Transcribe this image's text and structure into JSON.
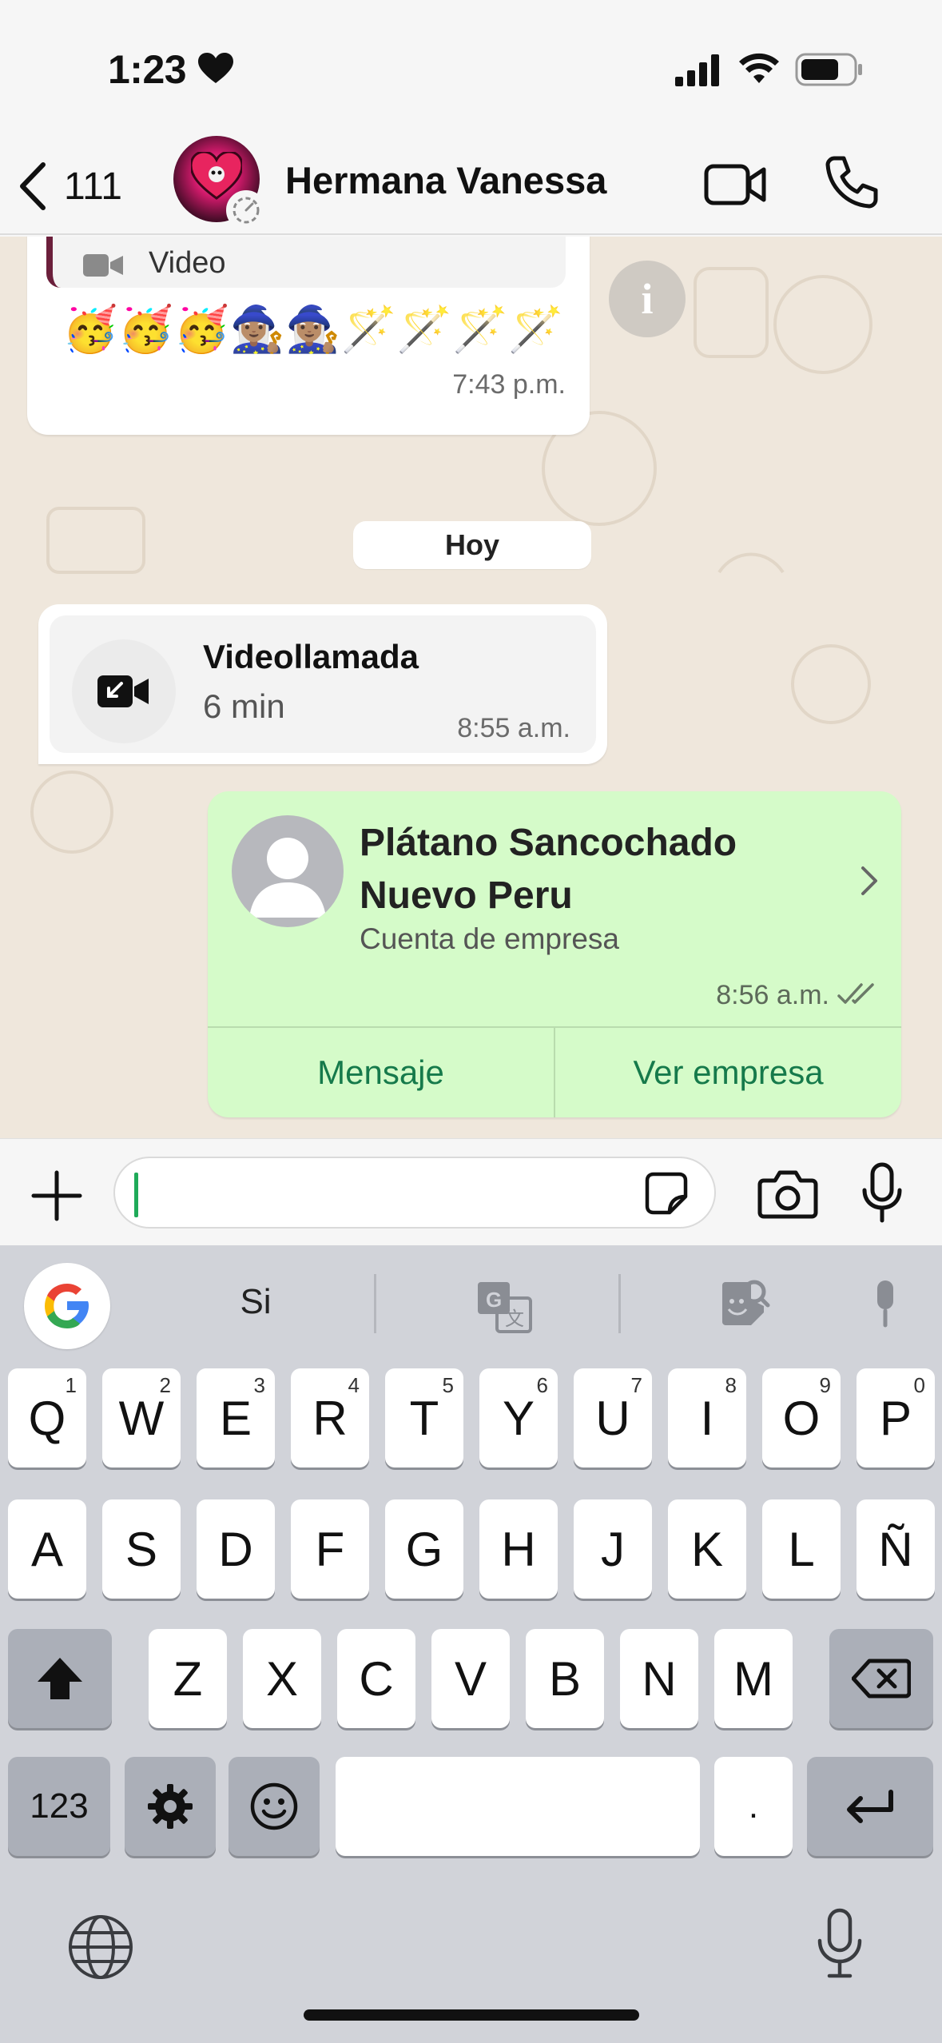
{
  "status_bar": {
    "time": "1:23"
  },
  "header": {
    "back_count": "111",
    "contact_name": "Hermana Vanessa"
  },
  "chat": {
    "quoted_message": {
      "label": "Video"
    },
    "emoji_message": {
      "text": "🥳🥳🥳🧙🏽‍♀️🧙🏽‍♀️🪄🪄🪄🪄",
      "time": "7:43 p.m."
    },
    "date_separator": "Hoy",
    "video_call": {
      "title": "Videollamada",
      "duration": "6 min",
      "time": "8:55 a.m."
    },
    "contact_card": {
      "name": "Plátano Sancochado Nuevo Peru",
      "subtitle": "Cuenta de empresa",
      "time": "8:56 a.m.",
      "actions": [
        "Mensaje",
        "Ver empresa"
      ]
    }
  },
  "composer": {
    "input_value": ""
  },
  "keyboard": {
    "suggestion": "Si",
    "row1": [
      {
        "key": "Q",
        "num": "1"
      },
      {
        "key": "W",
        "num": "2"
      },
      {
        "key": "E",
        "num": "3"
      },
      {
        "key": "R",
        "num": "4"
      },
      {
        "key": "T",
        "num": "5"
      },
      {
        "key": "Y",
        "num": "6"
      },
      {
        "key": "U",
        "num": "7"
      },
      {
        "key": "I",
        "num": "8"
      },
      {
        "key": "O",
        "num": "9"
      },
      {
        "key": "P",
        "num": "0"
      }
    ],
    "row2": [
      "A",
      "S",
      "D",
      "F",
      "G",
      "H",
      "J",
      "K",
      "L",
      "Ñ"
    ],
    "row3": [
      "Z",
      "X",
      "C",
      "V",
      "B",
      "N",
      "M"
    ],
    "numbers_key": "123",
    "period_key": "."
  },
  "colors": {
    "accent_green": "#167a4b",
    "outgoing_bubble": "#d5fbc9",
    "chat_background": "#efe7dc",
    "quote_bar": "#6b1f3b"
  },
  "icons": [
    "heart-icon",
    "signal-icon",
    "wifi-icon",
    "battery-icon",
    "back-chevron-icon",
    "video-camera-icon",
    "phone-icon",
    "info-icon",
    "incoming-video-call-icon",
    "chevron-right-icon",
    "double-check-icon",
    "plus-icon",
    "sticker-icon",
    "camera-icon",
    "microphone-icon",
    "google-icon",
    "translate-icon",
    "sticker-search-icon",
    "shift-icon",
    "backspace-icon",
    "gear-icon",
    "emoji-icon",
    "return-icon",
    "globe-icon"
  ]
}
